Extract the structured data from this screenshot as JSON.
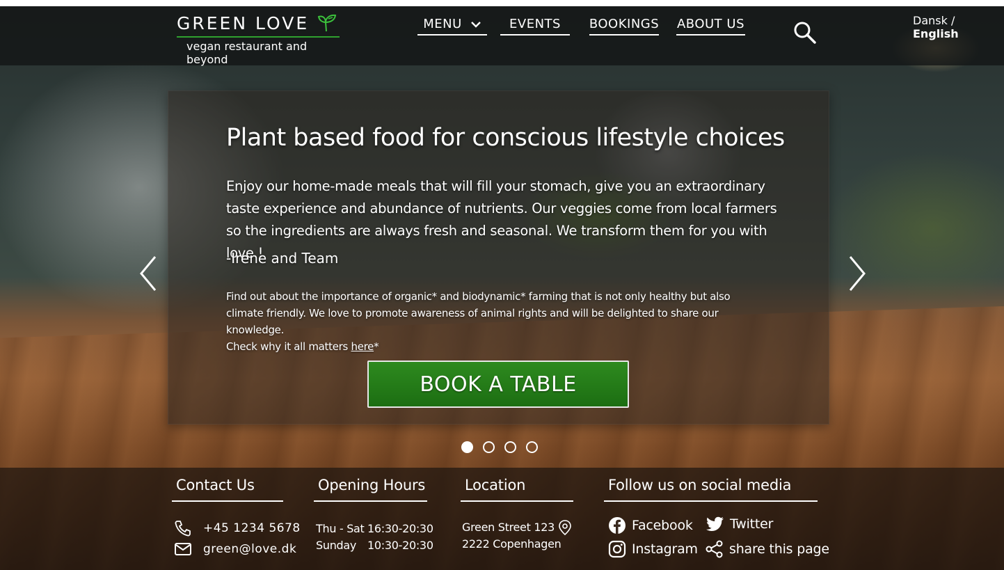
{
  "header": {
    "logo_title": "GREEN LOVE",
    "logo_subtitle": "vegan restaurant and beyond",
    "nav": {
      "menu": "MENU",
      "events": "EVENTS",
      "bookings": "BOOKINGS",
      "about": "ABOUT US"
    },
    "lang_other": "Dansk /",
    "lang_current": "English"
  },
  "hero": {
    "title": "Plant based food for conscious lifestyle choices",
    "text": "Enjoy our home-made meals that will fill your stomach, give you an extraordinary taste experience and abundance of nutrients.  Our veggies come from local farmers so the ingredients are always fresh and seasonal. We transform them for you with love !",
    "signature": "-Irene and Team",
    "small_text": "Find out about the importance of organic* and biodynamic* farming that is not only healthy but also climate friendly. We love to promote awareness of animal rights and will be delighted to share our knowledge.",
    "check_text": "Check why it all matters ",
    "here_link": "here",
    "asterisk": "*",
    "book_button": "BOOK A TABLE",
    "slides_total": 4,
    "active_slide": 1
  },
  "footer": {
    "contact": {
      "heading": "Contact  Us",
      "phone": "+45 1234 5678",
      "email": "green@love.dk"
    },
    "hours": {
      "heading": "Opening Hours",
      "row1_day": "Thu - Sat",
      "row1_time": "16:30-20:30",
      "row2_day": "Sunday",
      "row2_time": "10:30-20:30"
    },
    "location": {
      "heading": "Location",
      "street": "Green Street 123",
      "city": "2222 Copenhagen"
    },
    "social": {
      "heading": "Follow us on social media",
      "facebook": "Facebook",
      "twitter": "Twitter",
      "instagram": "Instagram",
      "share": "share this page"
    }
  },
  "colors": {
    "brand_green": "#2fa12f",
    "button_green": "#1f7a16"
  },
  "icons": [
    "leaf-logo-icon",
    "chevron-down-icon",
    "search-icon",
    "chevron-left-icon",
    "chevron-right-icon",
    "phone-icon",
    "mail-icon",
    "location-pin-icon",
    "facebook-icon",
    "twitter-icon",
    "instagram-icon",
    "share-icon"
  ]
}
